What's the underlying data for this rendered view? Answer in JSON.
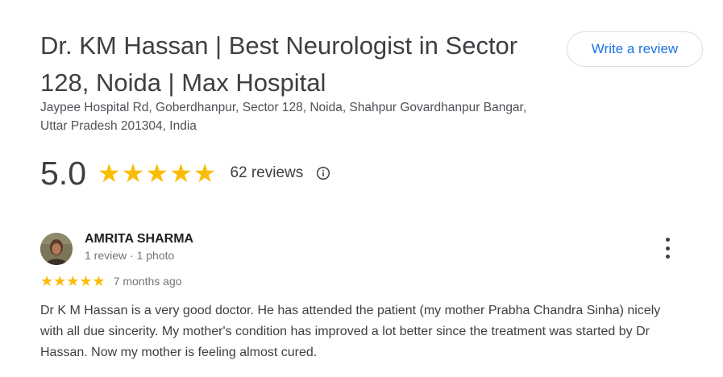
{
  "place": {
    "title": "Dr. KM Hassan | Best Neurologist in Sector 128, Noida | Max Hospital",
    "address": "Jaypee Hospital Rd, Goberdhanpur, Sector 128, Noida, Shahpur Govardhanpur Bangar, Uttar Pradesh 201304, India"
  },
  "actions": {
    "write_review_label": "Write a review"
  },
  "rating": {
    "score": "5.0",
    "stars": "★★★★★",
    "star_count": 5,
    "review_count_label": "62 reviews",
    "info_icon": "info-icon"
  },
  "review": {
    "reviewer_name": "AMRITA SHARMA",
    "reviewer_meta": "1 review · 1 photo",
    "stars": "★★★★★",
    "star_count": 5,
    "date": "7 months ago",
    "text": "Dr K M Hassan is a very good doctor. He has attended the patient (my mother Prabha Chandra Sinha) nicely with all due sincerity. My mother's condition has improved a lot better since the treatment was started by Dr Hassan. Now my mother is feeling almost cured.",
    "more_icon": "more-vertical-icon"
  },
  "colors": {
    "star": "#fbbc04",
    "link": "#1a73e8",
    "text": "#3c4043",
    "muted": "#70757a"
  }
}
